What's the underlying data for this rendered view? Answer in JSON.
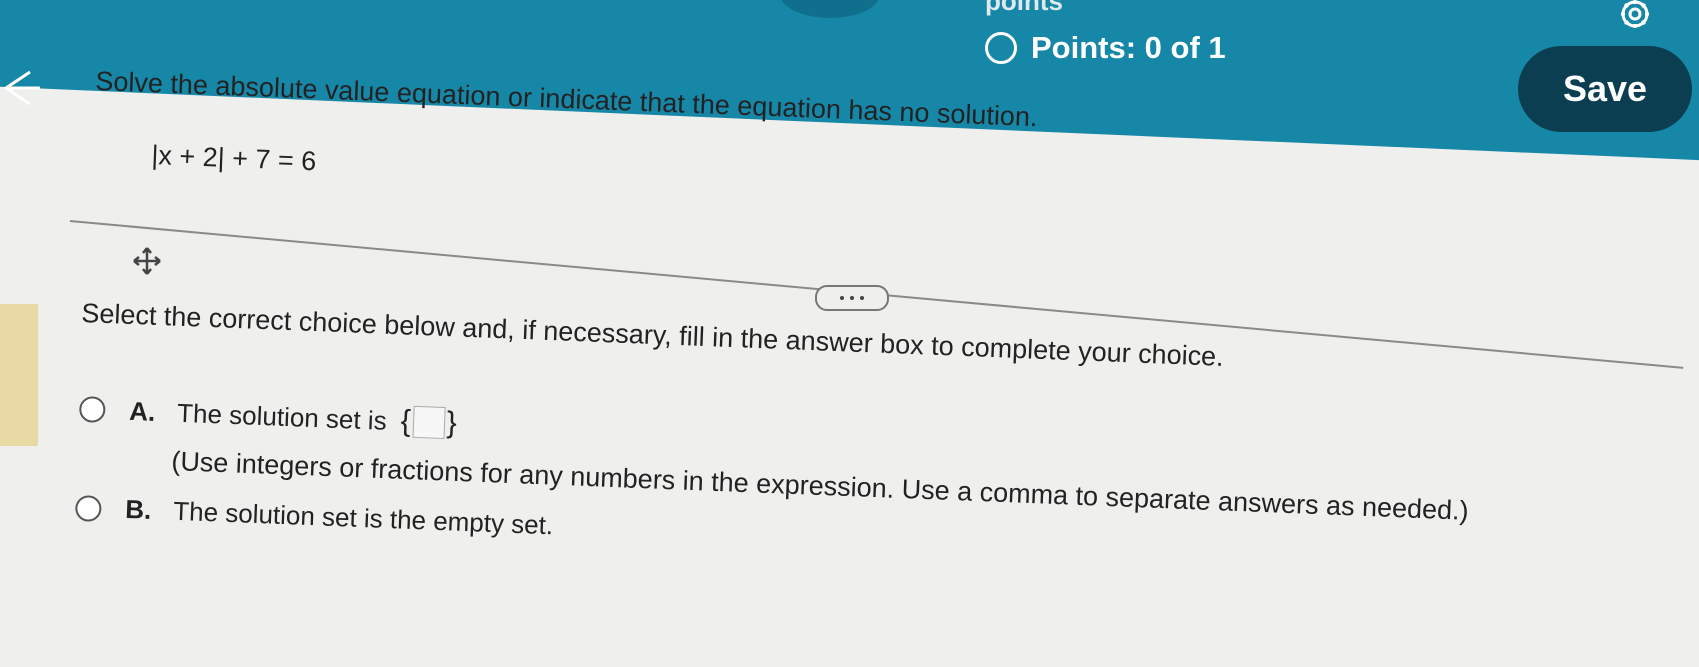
{
  "header": {
    "points_top": "points",
    "points_text": "Points: 0 of 1",
    "save_label": "Save"
  },
  "question": {
    "prompt": "Solve the absolute value equation or indicate that the equation has no solution.",
    "equation": "|x + 2| + 7 = 6"
  },
  "answer_section": {
    "instruction": "Select the correct choice below and, if necessary, fill in the answer box to complete your choice.",
    "choices": [
      {
        "letter": "A.",
        "text": "The solution set is",
        "brace_open": "{",
        "brace_close": "}",
        "answer_value": "",
        "hint": "(Use integers or fractions for any numbers in the expression. Use a comma to separate answers as needed.)"
      },
      {
        "letter": "B.",
        "text": "The solution set is the empty set."
      }
    ]
  },
  "colors": {
    "header_teal": "#1787a8",
    "save_button": "#0b3e51",
    "content_bg": "#efefed",
    "left_stripe": "#e8d9a5"
  },
  "icons": [
    "back-arrow-icon",
    "settings-gear-icon",
    "move-icon",
    "more-dots-icon"
  ]
}
